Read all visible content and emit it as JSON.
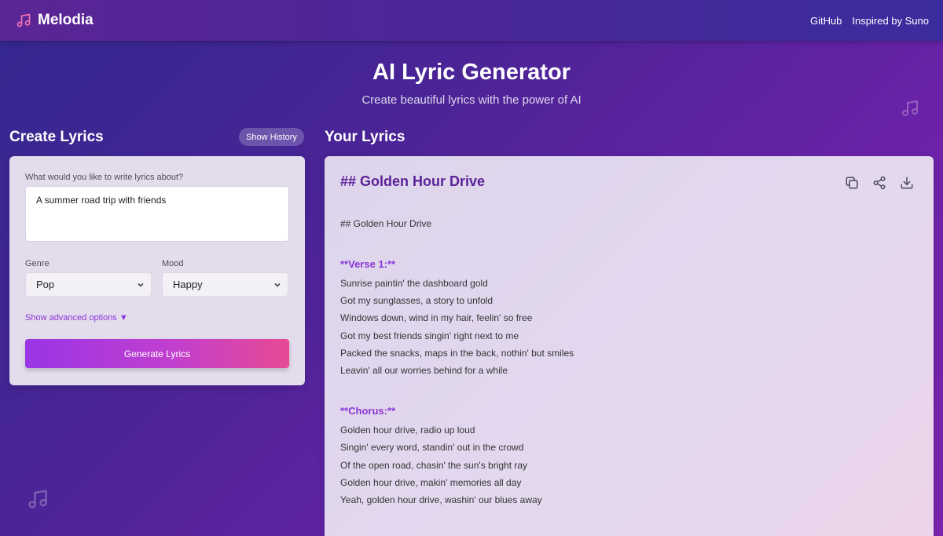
{
  "nav": {
    "brand": "Melodia",
    "links": [
      "GitHub",
      "Inspired by Suno"
    ]
  },
  "hero": {
    "title": "AI Lyric Generator",
    "subtitle": "Create beautiful lyrics with the power of AI"
  },
  "create": {
    "heading": "Create Lyrics",
    "history_button": "Show History",
    "topic_label": "What would you like to write lyrics about?",
    "topic_value": "A summer road trip with friends",
    "genre_label": "Genre",
    "genre_value": "Pop",
    "mood_label": "Mood",
    "mood_value": "Happy",
    "advanced_label": "Show advanced options ▼",
    "generate_button": "Generate Lyrics"
  },
  "lyrics": {
    "heading": "Your Lyrics",
    "title": "## Golden Hour Drive",
    "subtitle_line": "## Golden Hour Drive",
    "sections": [
      {
        "label": "**Verse 1:**",
        "lines": [
          "Sunrise paintin' the dashboard gold",
          "Got my sunglasses, a story to unfold",
          "Windows down, wind in my hair, feelin' so free",
          "Got my best friends singin' right next to me",
          "Packed the snacks, maps in the back, nothin' but smiles",
          "Leavin' all our worries behind for a while"
        ]
      },
      {
        "label": "**Chorus:**",
        "lines": [
          "Golden hour drive, radio up loud",
          "Singin' every word, standin' out in the crowd",
          "Of the open road, chasin' the sun's bright ray",
          "Golden hour drive, makin' memories all day",
          "Yeah, golden hour drive, washin' our blues away"
        ]
      }
    ]
  },
  "icons": {
    "brand": "music-note-icon",
    "actions": [
      "copy-icon",
      "share-icon",
      "download-icon"
    ]
  },
  "colors": {
    "accent": "#8b35d6",
    "title": "#5b2197",
    "button_start": "#9a35e6",
    "button_end": "#e74a93"
  }
}
